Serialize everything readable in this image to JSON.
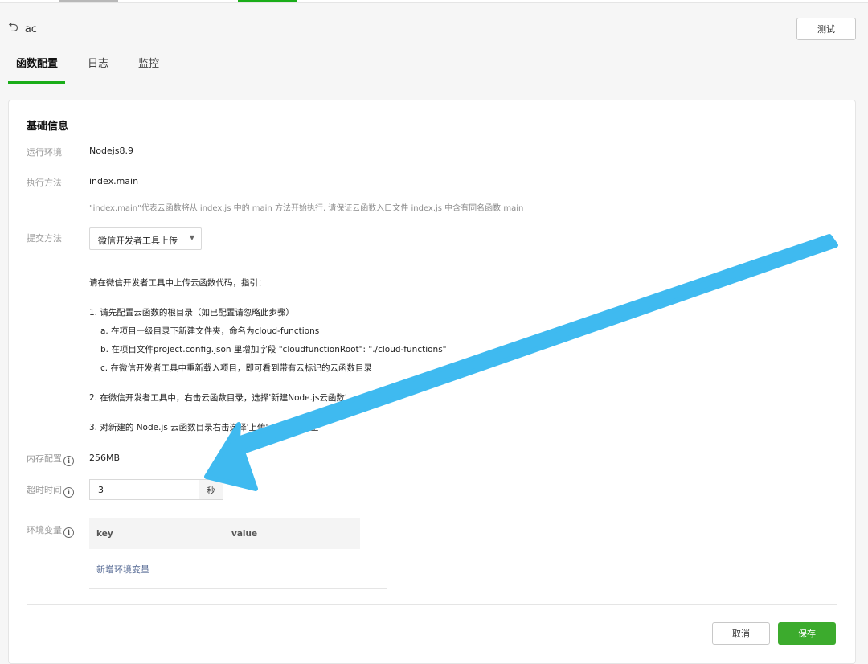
{
  "header": {
    "back_icon": "undo-arrow-icon",
    "function_name": "ac",
    "test_button": "测试"
  },
  "tabs": [
    {
      "label": "函数配置",
      "active": true
    },
    {
      "label": "日志",
      "active": false
    },
    {
      "label": "监控",
      "active": false
    }
  ],
  "basic": {
    "section_title": "基础信息",
    "runtime_label": "运行环境",
    "runtime_value": "Nodejs8.9",
    "handler_label": "执行方法",
    "handler_value": "index.main",
    "handler_hint": "\"index.main\"代表云函数将从 index.js 中的 main 方法开始执行, 请保证云函数入口文件 index.js 中含有同名函数 main",
    "submit_label": "提交方法",
    "submit_value": "微信开发者工具上传",
    "guide_intro": "请在微信开发者工具中上传云函数代码，指引：",
    "guide_1": "1. 请先配置云函数的根目录（如已配置请忽略此步骤）",
    "guide_1a": "a. 在项目一级目录下新建文件夹，命名为cloud-functions",
    "guide_1b": "b. 在项目文件project.config.json 里增加字段 \"cloudfunctionRoot\": \"./cloud-functions\"",
    "guide_1c": "c. 在微信开发者工具中重新载入项目，即可看到带有云标记的云函数目录",
    "guide_2": "2. 在微信开发者工具中，右击云函数目录，选择'新建Node.js云函数'",
    "guide_3": "3. 对新建的 Node.js 云函数目录右击选择'上传'，即可同步至",
    "memory_label": "内存配置",
    "memory_value": "256MB",
    "timeout_label": "超时时间",
    "timeout_value": "3",
    "timeout_unit": "秒",
    "env_label": "环境变量",
    "env_key_header": "key",
    "env_value_header": "value",
    "env_add": "新增环境变量"
  },
  "footer": {
    "cancel": "取消",
    "save": "保存"
  },
  "colors": {
    "accent": "#1aad19",
    "save_button": "#3cab2d",
    "link": "#576b95",
    "annotation_arrow": "#3fbaf0"
  }
}
